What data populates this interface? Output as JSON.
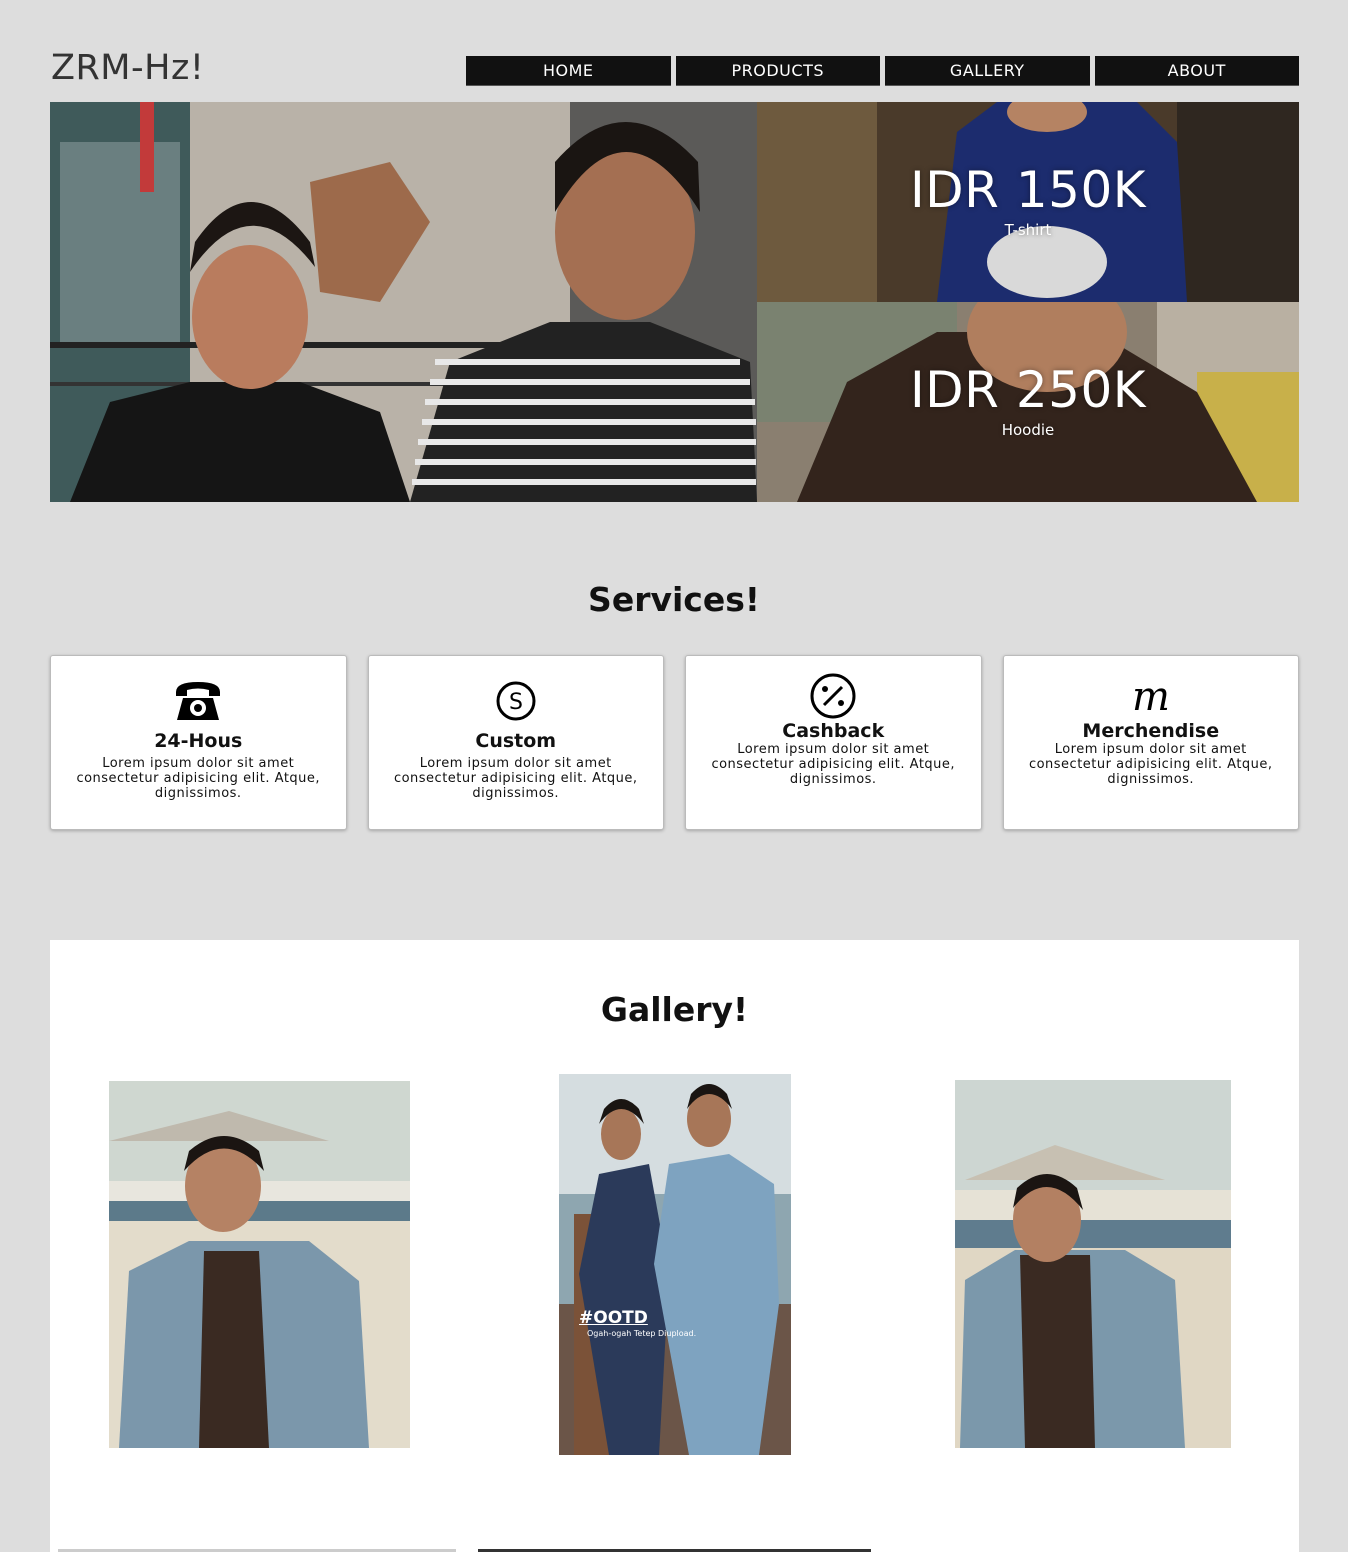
{
  "header": {
    "logo": "ZRM-Hz!"
  },
  "nav": [
    {
      "label": "HOME"
    },
    {
      "label": "PRODUCTS"
    },
    {
      "label": "GALLERY"
    },
    {
      "label": "ABOUT"
    }
  ],
  "hero": {
    "products": [
      {
        "price": "IDR 150K",
        "name": "T-shirt"
      },
      {
        "price": "IDR 250K",
        "name": "Hoodie"
      }
    ]
  },
  "services": {
    "title": "Services!",
    "items": [
      {
        "icon": "telephone-icon",
        "title": "24-Hous",
        "text": "Lorem ipsum dolor sit amet consectetur adipisicing elit. Atque, dignissimos."
      },
      {
        "icon": "s-circle-icon",
        "title": "Custom",
        "text": "Lorem ipsum dolor sit amet consectetur adipisicing elit. Atque, dignissimos."
      },
      {
        "icon": "percent-circle-icon",
        "title": "Cashback",
        "text": "Lorem ipsum dolor sit amet consectetur adipisicing elit. Atque, dignissimos."
      },
      {
        "icon": "script-m-icon",
        "title": "Merchendise",
        "text": "Lorem ipsum dolor sit amet consectetur adipisicing elit. Atque, dignissimos."
      }
    ]
  },
  "gallery": {
    "title": "Gallery!",
    "photo2_caption": "#OOTD",
    "photo2_subcaption": "Ogah-ogah Tetep Diupload."
  },
  "colors": {
    "background": "#dddddd",
    "nav_bg": "#111111",
    "card_bg": "#ffffff"
  }
}
